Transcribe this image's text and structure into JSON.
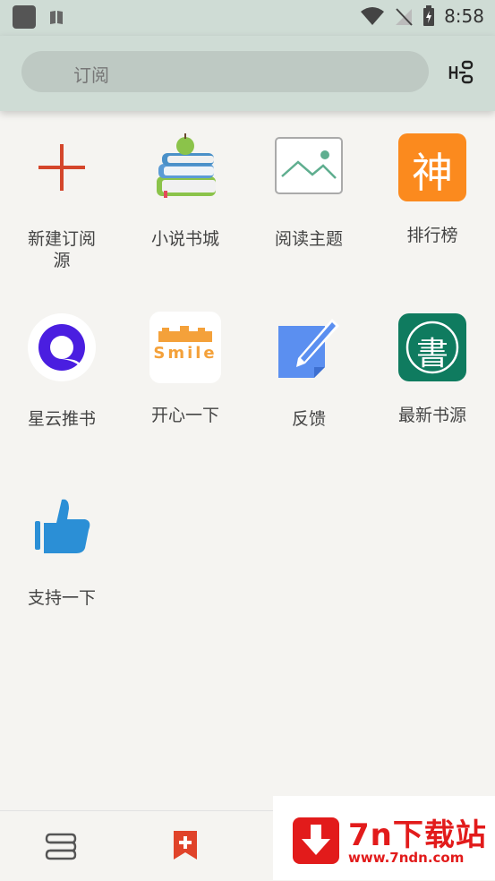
{
  "status_bar": {
    "time": "8:58"
  },
  "search": {
    "placeholder": "订阅"
  },
  "grid": {
    "items": [
      {
        "label": "新建订阅源"
      },
      {
        "label": "小说书城"
      },
      {
        "label": "阅读主题"
      },
      {
        "label": "排行榜",
        "icon_char": "神"
      },
      {
        "label": "星云推书"
      },
      {
        "label": "开心一下",
        "icon_text": "Smile"
      },
      {
        "label": "反馈"
      },
      {
        "label": "最新书源",
        "icon_char": "書"
      },
      {
        "label": "支持一下"
      }
    ]
  },
  "watermark": {
    "title": "7n下载站",
    "url": "www.7ndn.com"
  },
  "colors": {
    "accent_red": "#d4462b",
    "header_bg": "#cfdcd5",
    "bookmark_red": "#e0432a"
  }
}
